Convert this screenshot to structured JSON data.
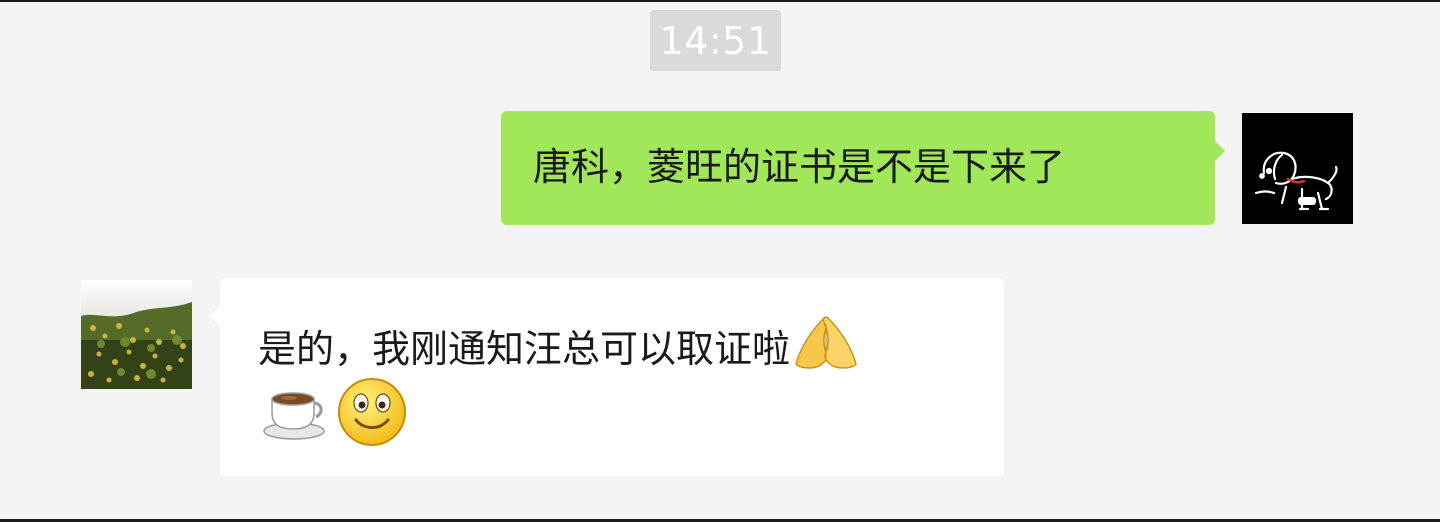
{
  "chat": {
    "timestamp": "14:51",
    "outgoing": {
      "text": "唐科，菱旺的证书是不是下来了",
      "bubble_color": "#a0e75a"
    },
    "incoming": {
      "text": "是的，我刚通知汪总可以取证啦",
      "emojis": [
        "pray-hands-icon",
        "coffee-cup-icon",
        "smile-face-icon"
      ],
      "bubble_color": "#ffffff"
    },
    "background_color": "#f4f4f4"
  }
}
